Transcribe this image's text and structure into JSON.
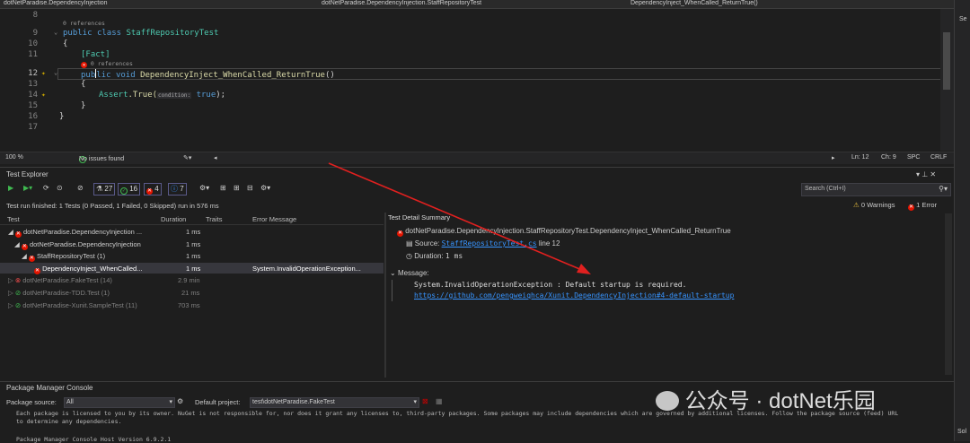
{
  "navbar": {
    "project": "dotNetParadise.DependencyInjection",
    "class": "dotNetParadise.DependencyInjection.StaffRepositoryTest",
    "method": "DependencyInject_WhenCalled_ReturnTrue()"
  },
  "editor": {
    "lines": [
      "8",
      "9",
      "10",
      "11",
      "12",
      "13",
      "14",
      "15",
      "16",
      "17"
    ],
    "refs_class": "0 references",
    "kw_public": "public",
    "kw_class": "class",
    "class_name": "StaffRepositoryTest",
    "brace_open": "{",
    "brace_close": "}",
    "attr": "[Fact]",
    "refs_method": "0 references",
    "kw_void": "void",
    "method_name": "DependencyInject_WhenCalled_ReturnTrue",
    "parens": "()",
    "assert_type": "Assert",
    "assert_method": ".True(",
    "param_hint": "condition:",
    "kw_true": "true",
    "stmt_end": ");",
    "pub_a": "pub",
    "pub_b": "lic"
  },
  "edstatus": {
    "zoom": "100 %",
    "issues": "No issues found",
    "ln": "Ln: 12",
    "ch": "Ch: 9",
    "spc": "SPC",
    "crlf": "CRLF"
  },
  "test_explorer": {
    "title": "Test Explorer",
    "counts": {
      "total": "27",
      "passed": "16",
      "failed": "4",
      "info": "7"
    },
    "search_placeholder": "Search (Ctrl+I)",
    "run_summary": "Test run finished: 1 Tests (0 Passed, 1 Failed, 0 Skipped) run in 576 ms",
    "warnings": "0 Warnings",
    "errors": "1 Error",
    "columns": {
      "test": "Test",
      "duration": "Duration",
      "traits": "Traits",
      "error": "Error Message"
    },
    "rows": [
      {
        "name": "dotNetParadise.DependencyInjection ...",
        "duration": "1 ms",
        "error": ""
      },
      {
        "name": "dotNetParadise.DependencyInjection",
        "duration": "1 ms",
        "error": ""
      },
      {
        "name": "StaffRepositoryTest (1)",
        "duration": "1 ms",
        "error": ""
      },
      {
        "name": "DependencyInject_WhenCalled...",
        "duration": "1 ms",
        "error": "System.InvalidOperationException..."
      },
      {
        "name": "dotNetParadise.FakeTest (14)",
        "duration": "2.9 min",
        "error": ""
      },
      {
        "name": "dotNetParadise-TDD.Test (1)",
        "duration": "21 ms",
        "error": ""
      },
      {
        "name": "dotNetParadise-Xunit.SampleTest (11)",
        "duration": "703 ms",
        "error": ""
      }
    ],
    "detail": {
      "title": "Test Detail Summary",
      "test_name": "dotNetParadise.DependencyInjection.StaffRepositoryTest.DependencyInject_WhenCalled_ReturnTrue",
      "source_label": "Source:",
      "source_file": "StaffRepositoryTest.cs",
      "source_line": "line 12",
      "duration_label": "Duration:",
      "duration_value": "1 ms",
      "message_label": "Message:",
      "message_text": "System.InvalidOperationException : Default startup is required.",
      "message_link": "https://github.com/pengweiqhca/Xunit.DependencyInjection#4-default-startup"
    }
  },
  "pmc": {
    "title": "Package Manager Console",
    "source_label": "Package source:",
    "source_value": "All",
    "project_label": "Default project:",
    "project_value": "test\\dotNetParadise.FakeTest",
    "license_text": "Each package is licensed to you by its owner. NuGet is not responsible for, nor does it grant any licenses to, third-party packages. Some packages may include dependencies which are governed by additional licenses. Follow the package source (feed) URL",
    "license_text2": "to determine any dependencies.",
    "host_text": "Package Manager Console Host Version 6.9.2.1"
  },
  "watermark": "公众号 · dotNet乐园",
  "right_strip": {
    "top": "Se",
    "bottom": "Sol"
  },
  "colors": {
    "accent": "#3794ff",
    "fail": "#e51400",
    "pass": "#3fb950",
    "arrow": "#e0201f"
  }
}
